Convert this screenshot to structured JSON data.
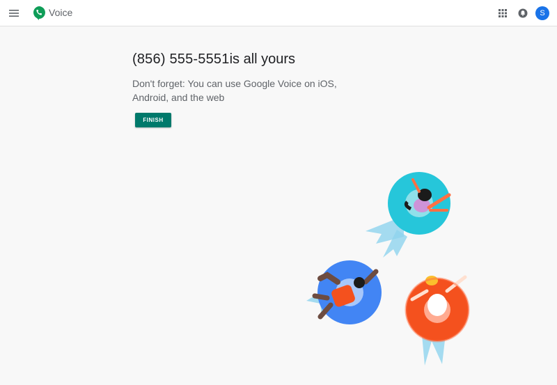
{
  "header": {
    "app_name": "Voice",
    "menu_icon": "menu-icon",
    "logo_icon": "voice-logo-icon",
    "apps_icon": "apps-grid-icon",
    "notifications_icon": "bell-icon",
    "avatar_letter": "S"
  },
  "main": {
    "phone_number": "(856) 555-5551",
    "headline_suffix": "is all yours",
    "subtext": "Don't forget: You can use Google Voice on iOS, Android, and the web",
    "finish_label": "FINISH"
  },
  "colors": {
    "accent": "#00796b",
    "logo_green": "#0f9d58",
    "avatar_blue": "#1a73e8",
    "float_teal": "#26c6da",
    "float_blue": "#4285f4",
    "float_orange": "#f4511e"
  }
}
